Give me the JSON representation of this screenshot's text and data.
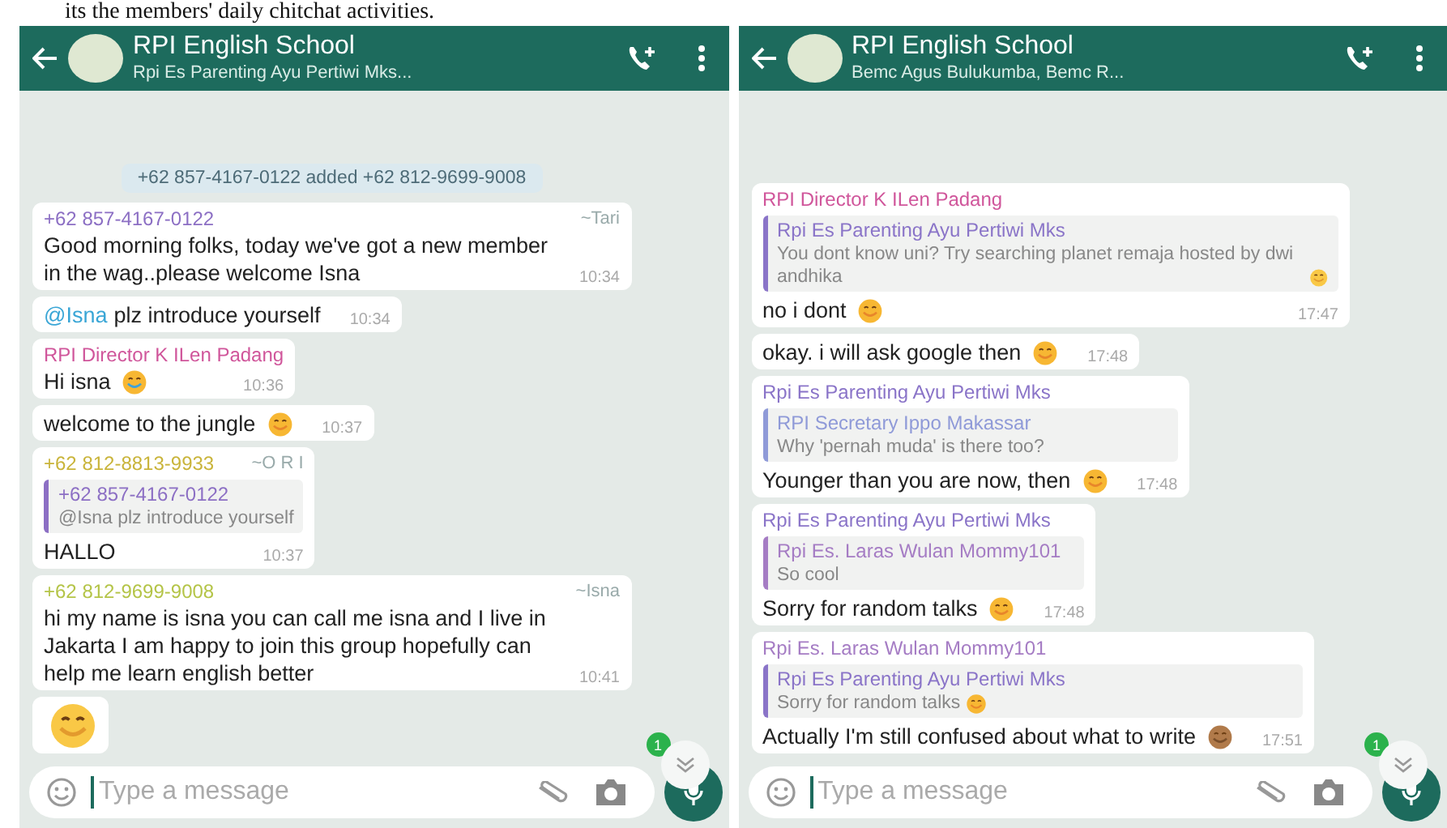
{
  "caption": "its the members' daily chitchat activities.",
  "panels": [
    {
      "header": {
        "title": "RPI English School",
        "subtitle": "Rpi Es Parenting Ayu Pertiwi Mks..."
      },
      "messages": [
        {
          "kind": "system",
          "text": "+62 857-4167-0122 added +62 812-9699-9008"
        },
        {
          "kind": "message",
          "sender": "+62 857-4167-0122",
          "color": "#8c6fc4",
          "handle": "~Tari",
          "text": "Good morning folks, today we've got a new member in the wag..please welcome Isna",
          "time": "10:34"
        },
        {
          "kind": "message",
          "mention": "@Isna",
          "text": "plz introduce yourself",
          "time": "10:34"
        },
        {
          "kind": "message",
          "sender": "RPI Director K ILen Padang",
          "color": "#d0569b",
          "text": "Hi isna",
          "emoji": {
            "kind": "wave"
          },
          "time": "10:36"
        },
        {
          "kind": "message",
          "text": "welcome to the jungle",
          "emoji": {
            "kind": "smile"
          },
          "time": "10:37"
        },
        {
          "kind": "message",
          "sender": "+62 812-8813-9933",
          "color": "#c9b43a",
          "handle": "~O R I",
          "quote": {
            "sender": "+62 857-4167-0122",
            "color": "#8c6fc4",
            "text": "@Isna plz introduce yourself"
          },
          "text": "HALLO",
          "time": "10:37"
        },
        {
          "kind": "message",
          "sender": "+62 812-9699-9008",
          "color": "#b4c447",
          "handle": "~Isna",
          "text": "hi my name is isna you can call me isna and I live in Jakarta I am happy to join this group hopefully can help me learn english better",
          "time": "10:41"
        },
        {
          "kind": "big_emoji",
          "emoji": {
            "kind": "grin"
          }
        }
      ],
      "unread": "1",
      "input": {
        "placeholder": "Type a message"
      }
    },
    {
      "header": {
        "title": "RPI English School",
        "subtitle": "Bemc Agus Bulukumba, Bemc R..."
      },
      "messages": [
        {
          "kind": "message",
          "sender": "RPI Director K ILen Padang",
          "color": "#d0569b",
          "quote": {
            "sender": "Rpi Es Parenting Ayu Pertiwi Mks",
            "color": "#8a74c8",
            "text": "You dont know uni? Try searching planet remaja hosted by dwi andhika",
            "emoji": {
              "kind": "grin"
            }
          },
          "text": "no i dont",
          "emoji": {
            "kind": "smile"
          },
          "time": "17:47"
        },
        {
          "kind": "message",
          "text": "okay. i will ask google then",
          "emoji": {
            "kind": "smile"
          },
          "time": "17:48"
        },
        {
          "kind": "message",
          "sender": "Rpi Es Parenting Ayu Pertiwi Mks",
          "color": "#8a74c8",
          "quote": {
            "sender": "RPI Secretary Ippo Makassar",
            "color": "#8f9ad8",
            "text": "Why 'pernah muda' is there too?"
          },
          "text": "Younger than you are now, then",
          "emoji": {
            "kind": "smile"
          },
          "time": "17:48"
        },
        {
          "kind": "message",
          "sender": "Rpi Es Parenting Ayu Pertiwi Mks",
          "color": "#8a74c8",
          "quote": {
            "sender": "Rpi Es. Laras Wulan Mommy101",
            "color": "#a57cc4",
            "text": "So cool"
          },
          "text": "Sorry for random talks",
          "emoji": {
            "kind": "smile"
          },
          "time": "17:48"
        },
        {
          "kind": "message",
          "sender": "Rpi Es. Laras Wulan Mommy101",
          "color": "#a57cc4",
          "quote": {
            "sender": "Rpi Es Parenting Ayu Pertiwi Mks",
            "color": "#8a74c8",
            "text": "Sorry for random talks",
            "emoji": {
              "kind": "smile"
            }
          },
          "text": "Actually I'm still confused about what to write",
          "emoji": {
            "kind": "monkey"
          },
          "time": "17:51"
        }
      ],
      "unread": "1",
      "input": {
        "placeholder": "Type a message"
      }
    }
  ]
}
